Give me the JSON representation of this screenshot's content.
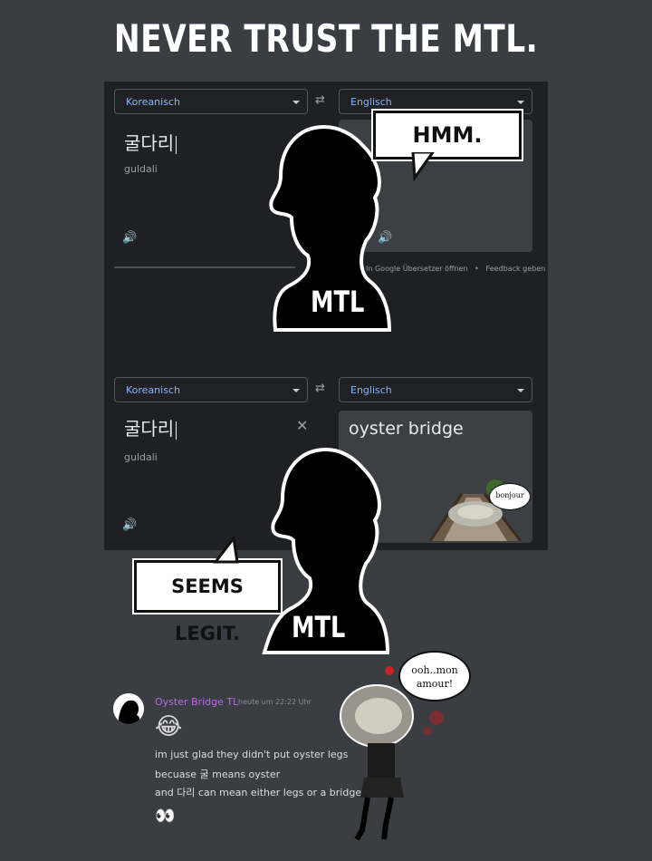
{
  "title": "NEVER TRUST THE MTL.",
  "translator_top": {
    "source_lang": "Koreanisch",
    "target_lang": "Englisch",
    "source_text": "굴다리",
    "transliteration": "guldali",
    "footer_open": "In Google Übersetzer öffnen",
    "footer_sep": "•",
    "footer_feedback": "Feedback geben"
  },
  "translator_bottom": {
    "source_lang": "Koreanisch",
    "target_lang": "Englisch",
    "source_text": "굴다리",
    "transliteration": "guldali",
    "output_text": "oyster bridge"
  },
  "bubbles": {
    "hmm": "HMM.",
    "seems_legit": "SEEMS LEGIT.",
    "bonjour": "bonjour",
    "amour_line1": "ooh..mon",
    "amour_line2": "amour!"
  },
  "silhouette_label": "MTL",
  "chat": {
    "username": "Oyster Bridge TL",
    "timestamp": "heute um 22:22 Uhr",
    "emoji": "😂",
    "lines": [
      "im just glad they didn't put oyster legs",
      "becuase 굴 means oyster",
      "and 다리 can mean either legs or a bridge"
    ],
    "reaction": "👀"
  },
  "colors": {
    "background": "#3a3d41",
    "panel": "#1f2023",
    "lang_accent": "#8ab4f8",
    "username": "#b46ee0"
  },
  "icons": [
    "swap-icon",
    "speaker-icon",
    "close-icon",
    "chevron-down-icon"
  ]
}
